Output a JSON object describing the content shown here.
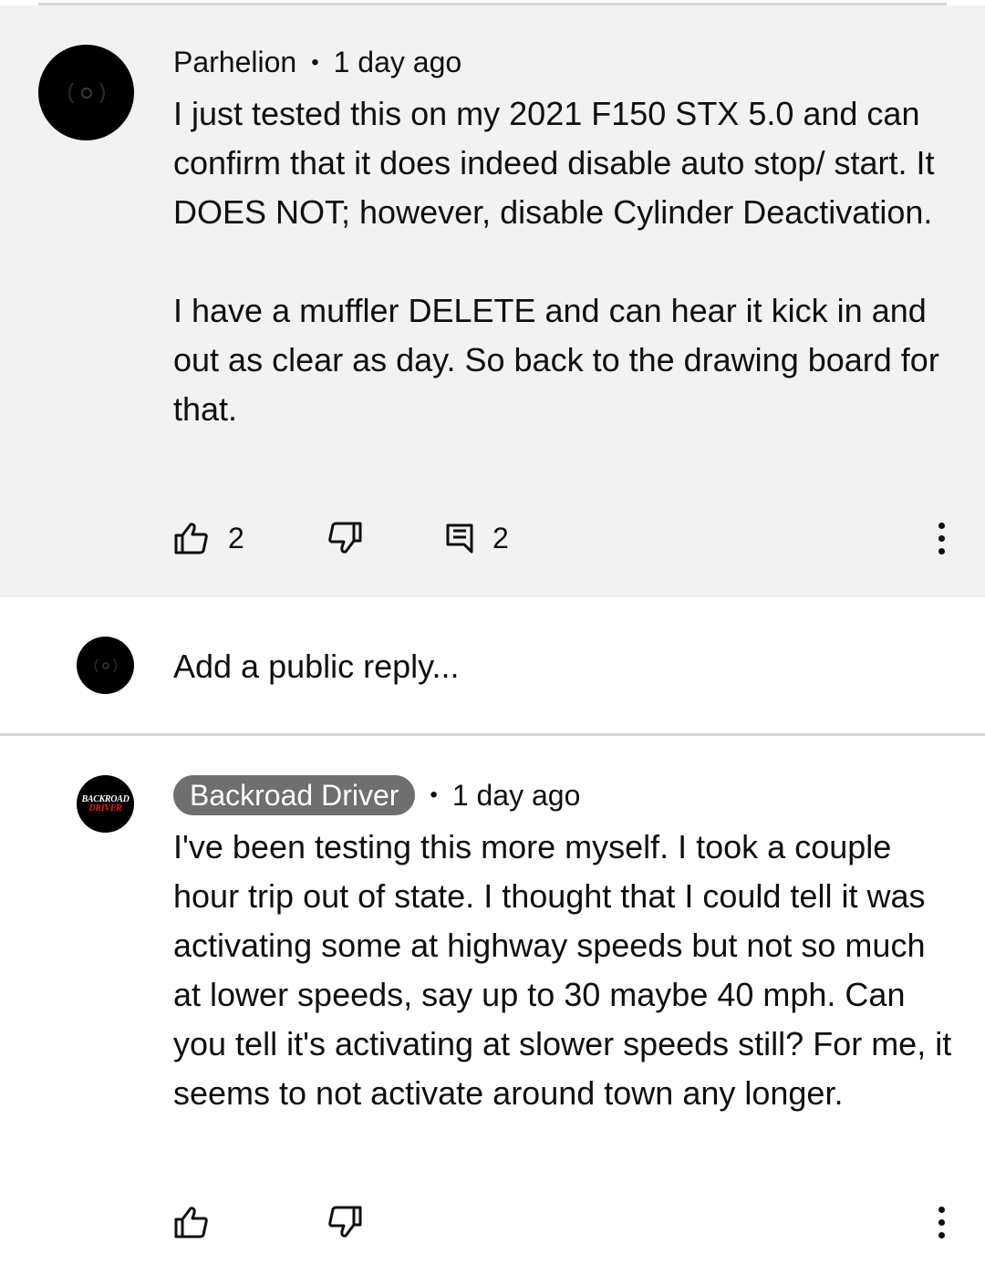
{
  "comment": {
    "author": "Parhelion",
    "separator": "•",
    "time": "1 day ago",
    "paragraphs": [
      "I just tested this on my 2021 F150 STX 5.0 and can confirm that it does indeed disable auto stop/ start. It DOES NOT; however, disable Cylinder Deactivation.",
      "I have a muffler DELETE and can hear it kick in and out as clear as day. So back to the drawing board for that."
    ],
    "like_count": "2",
    "reply_count": "2"
  },
  "reply_box": {
    "placeholder": "Add a public reply..."
  },
  "reply": {
    "author": "Backroad Driver",
    "separator": "•",
    "time": "1 day ago",
    "avatar_text_top": "BACKROAD",
    "avatar_text_bottom": "DRIVER",
    "text": "I've been testing this more myself. I took a couple hour trip out of state. I thought that I could tell it was activating some at highway speeds but not so much at lower speeds, say up to 30 maybe 40 mph. Can you tell it's activating at slower speeds still? For me, it seems to not activate around town any longer."
  },
  "icons": {
    "like": "thumbs-up-icon",
    "dislike": "thumbs-down-icon",
    "reply": "comment-icon",
    "menu": "more-vert-icon"
  },
  "colors": {
    "comment_bg": "#f2f2f2",
    "author_chip_bg": "#6f6f6f",
    "brand_red": "#e31b23"
  }
}
